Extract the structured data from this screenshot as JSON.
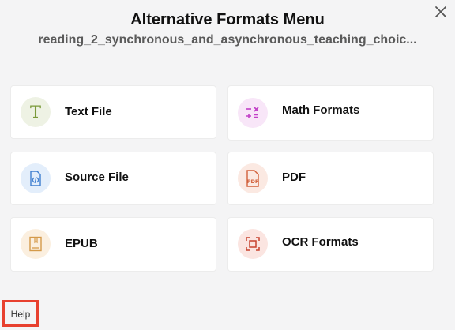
{
  "dialog": {
    "title": "Alternative Formats Menu",
    "subtitle": "reading_2_synchronous_and_asynchronous_teaching_choic..."
  },
  "formats": [
    {
      "label": "Text File",
      "icon": "text-file-icon",
      "color": "#7a9a3a"
    },
    {
      "label": "Math Formats",
      "icon": "math-icon",
      "color": "#c23fc7"
    },
    {
      "label": "Source File",
      "icon": "source-code-icon",
      "color": "#3f7fd0"
    },
    {
      "label": "PDF",
      "icon": "pdf-icon",
      "color": "#d2603a"
    },
    {
      "label": "EPUB",
      "icon": "epub-book-icon",
      "color": "#d49a4a"
    },
    {
      "label": "OCR Formats",
      "icon": "ocr-scan-icon",
      "color": "#c8432f"
    }
  ],
  "footer": {
    "help_label": "Help"
  }
}
